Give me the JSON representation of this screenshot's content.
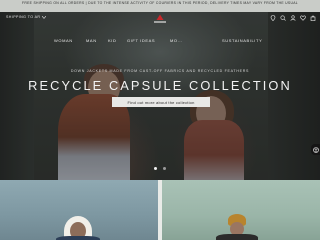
{
  "promo": {
    "text": "FREE SHIPPING ON ALL ORDERS | DUE TO THE INTENSE ACTIVITY OF COURIERS IN THIS PERIOD, DELIVERY TIMES MAY VARY FROM THE USUAL"
  },
  "header": {
    "shipping_to": "SHIPPING TO AR",
    "icons": [
      "location-icon",
      "search-icon",
      "user-icon",
      "wishlist-icon",
      "bag-icon"
    ]
  },
  "nav": {
    "items": [
      "WOMAN",
      "MAN",
      "KID",
      "GIFT IDEAS",
      "MO...",
      "SUSTAINABILITY"
    ]
  },
  "hero": {
    "subtitle": "DOWN JACKETS MADE FROM CAST-OFF FABRICS AND RECYCLED FEATHERS",
    "headline": "RECYCLE CAPSULE COLLECTION",
    "cta": "Find out more about the collection",
    "slide_count": 2,
    "active_slide": 1
  },
  "colors": {
    "promo_bg": "#c9ccc8",
    "cta_bg": "#e8e8e6",
    "logo_red": "#c8282b"
  }
}
